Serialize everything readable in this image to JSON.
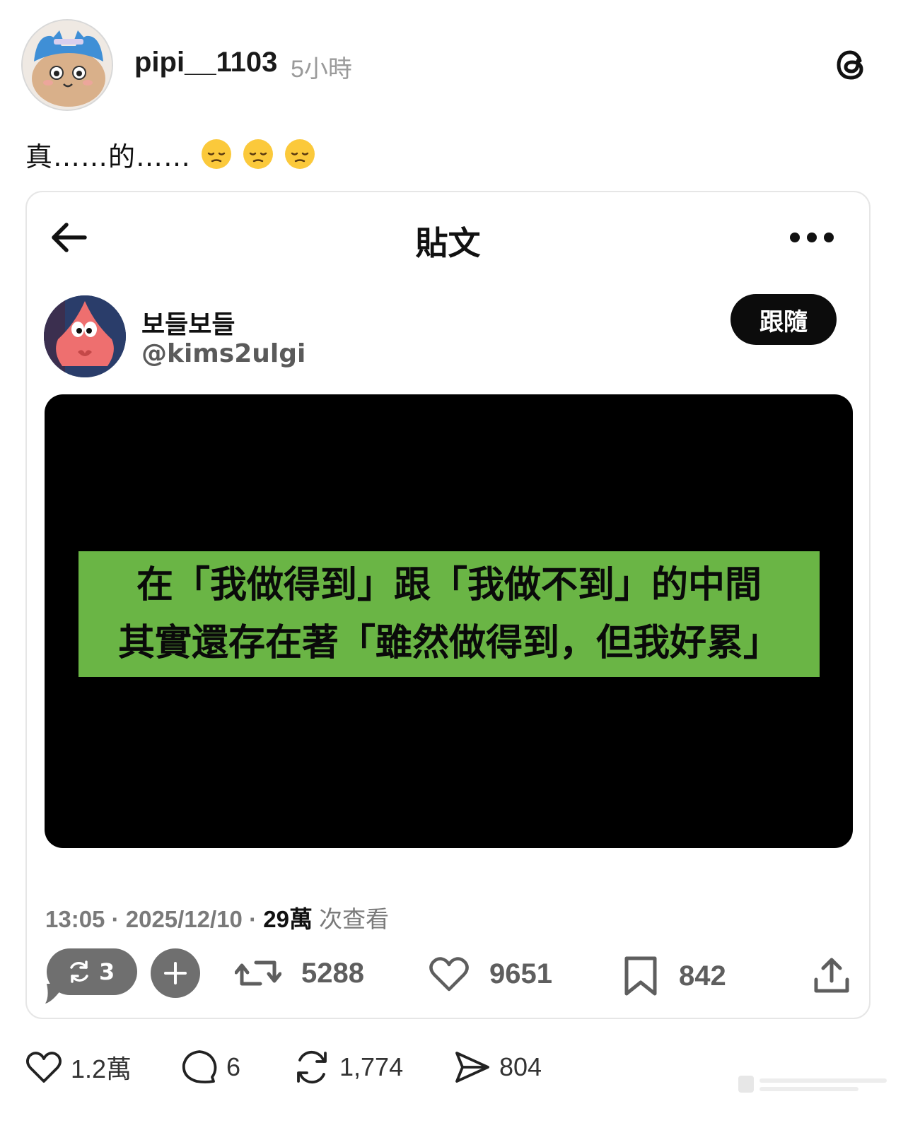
{
  "post": {
    "username": "pipi__1103",
    "time_ago": "5小時",
    "caption": "真……的……",
    "caption_emojis": [
      "pensive-face",
      "pensive-face",
      "pensive-face"
    ]
  },
  "embedded": {
    "header_title": "貼文",
    "author_name": "보들보들",
    "author_handle": "@kims2ulgi",
    "follow_label": "跟隨",
    "image_text_lines": [
      "在「我做得到」跟「我做不到」的中間",
      "其實還存在著「雖然做得到，但我好累」"
    ],
    "banner_color": "#6ab545",
    "meta": {
      "time": "13:05",
      "date": "2025/12/10",
      "views_num": "29萬",
      "views_label": "次查看"
    },
    "actions": {
      "quote_count": "3",
      "retweets": "5288",
      "likes": "9651",
      "bookmarks": "842"
    }
  },
  "footer": {
    "likes": "1.2萬",
    "comments": "6",
    "reposts": "1,774",
    "shares": "804"
  }
}
